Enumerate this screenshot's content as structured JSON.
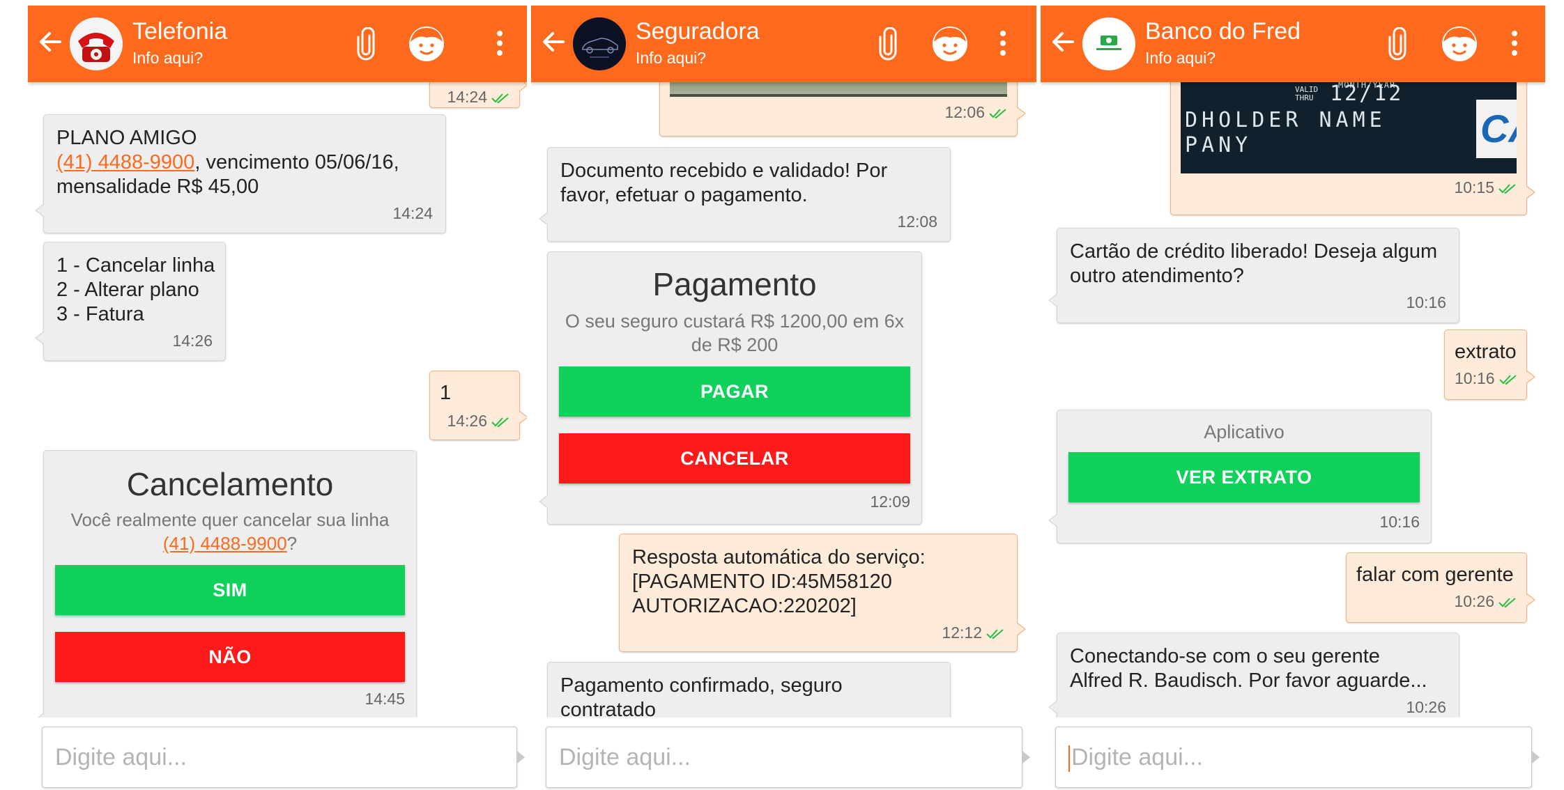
{
  "theme": {
    "accent": "#fd6a1e",
    "accept_button": "#10d15a",
    "reject_button": "#fc1a1a",
    "incoming_bubble": "#eeeeee",
    "outgoing_bubble": "#ffebd9"
  },
  "panels": [
    {
      "header": {
        "title": "Telefonia",
        "subtitle": "Info aqui?",
        "avatar": "red-telephone-avatar"
      },
      "messages": {
        "m0_time": "14:24",
        "m1": {
          "line1": "PLANO AMIGO",
          "link": "(41) 4488-9900",
          "line2_rest": ", vencimento 05/06/16,",
          "line3": "mensalidade R$ 45,00",
          "time": "14:24"
        },
        "m2": {
          "line1": "1 - Cancelar linha",
          "line2": "2 - Alterar plano",
          "line3": "3 - Fatura",
          "time": "14:26"
        },
        "m3": {
          "text": "1",
          "time": "14:26"
        },
        "card": {
          "title": "Cancelamento",
          "desc": "Você realmente quer cancelar sua linha",
          "link": "(41) 4488-9900",
          "desc_end": "?",
          "yes": "SIM",
          "no": "NÃO",
          "time": "14:45"
        }
      },
      "input_placeholder": "Digite aqui..."
    },
    {
      "header": {
        "title": "Seguradora",
        "subtitle": "Info aqui?",
        "avatar": "car-logo-avatar"
      },
      "messages": {
        "m0_time": "12:06",
        "m1": {
          "line1": "Documento recebido e validado! Por",
          "line2": "favor, efetuar o pagamento.",
          "time": "12:08"
        },
        "card": {
          "title": "Pagamento",
          "desc1": "O seu seguro custará R$ 1200,00 em 6x",
          "desc2": "de R$ 200",
          "pay": "PAGAR",
          "cancel": "CANCELAR",
          "time": "12:09"
        },
        "m2": {
          "line1": "Resposta automática do serviço:",
          "line2": "[PAGAMENTO ID:45M58120",
          "line3": "AUTORIZACAO:220202]",
          "time": "12:12"
        },
        "m3": {
          "line1": "Pagamento confirmado, seguro",
          "line2": "contratado"
        }
      },
      "input_placeholder": "Digite aqui..."
    },
    {
      "header": {
        "title": "Banco do Fred",
        "subtitle": "Info aqui?",
        "avatar": "bank-logo-avatar"
      },
      "messages": {
        "m0": {
          "card_month_year": "MONTH/YEAR",
          "card_valid": "VALID",
          "card_thru": "THRU",
          "card_date": "12/12",
          "card_line1": "DHOLDER NAME",
          "card_line2": "PANY",
          "card_logo": "CA",
          "time": "10:15"
        },
        "m1": {
          "line1": "Cartão de crédito liberado! Deseja algum",
          "line2": "outro atendimento?",
          "time": "10:16"
        },
        "m2": {
          "text": "extrato",
          "time": "10:16"
        },
        "card": {
          "subtitle": "Aplicativo",
          "button": "VER EXTRATO",
          "time": "10:16"
        },
        "m3": {
          "text": "falar com gerente",
          "time": "10:26"
        },
        "m4": {
          "line1": "Conectando-se com o seu gerente",
          "line2": "Alfred R. Baudisch. Por favor aguarde...",
          "time": "10:26"
        }
      },
      "input_placeholder": "Digite aqui..."
    }
  ]
}
